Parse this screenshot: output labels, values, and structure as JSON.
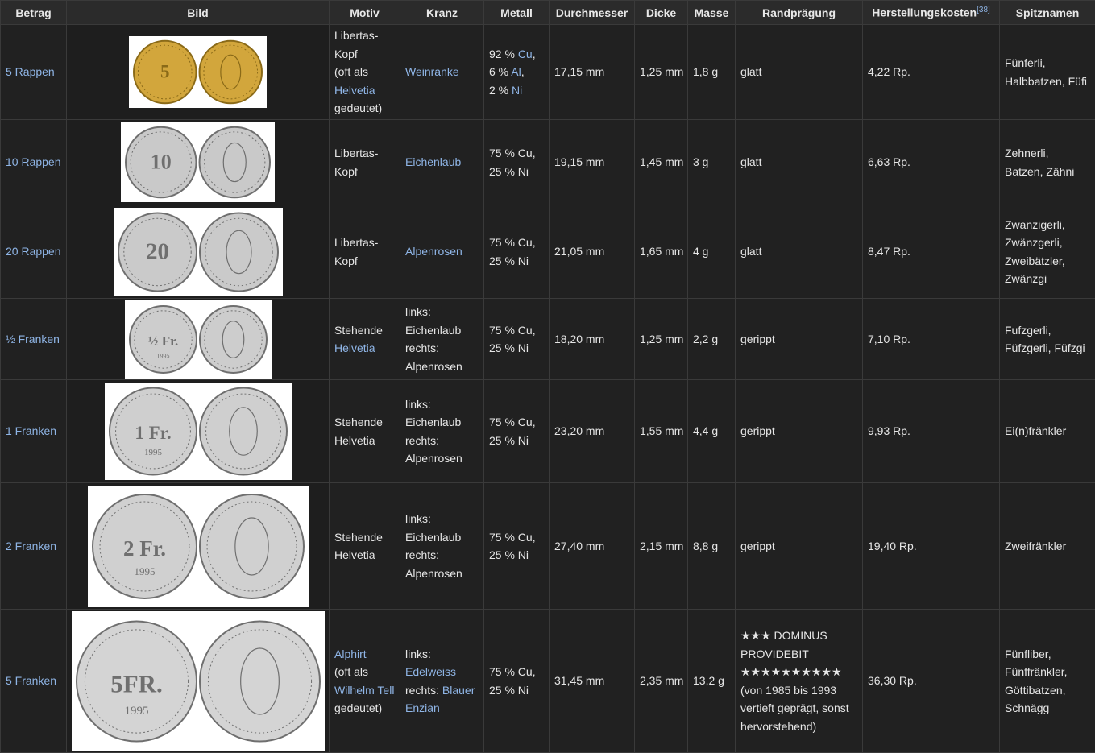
{
  "headers": {
    "betrag": "Betrag",
    "bild": "Bild",
    "motiv": "Motiv",
    "kranz": "Kranz",
    "metall": "Metall",
    "durchmesser": "Durchmesser",
    "dicke": "Dicke",
    "masse": "Masse",
    "rand": "Randprägung",
    "kosten": "Herstellungskosten",
    "kosten_ref": "[38]",
    "spitz": "Spitznamen"
  },
  "rows": [
    {
      "betrag": "5 Rappen",
      "coin_color": "#d2a63c",
      "coin_text": "5",
      "motiv": [
        "Libertas-",
        "Kopf",
        "(oft als",
        "Helvetia",
        "gedeutet)"
      ],
      "kranz": [
        "Weinranke"
      ],
      "metall": [
        "92 % Cu,",
        "6 % Al,",
        "2 % Ni"
      ],
      "durchmesser": "17,15 mm",
      "dicke": "1,25 mm",
      "masse": "1,8 g",
      "rand": [
        "glatt"
      ],
      "kosten": "4,22 Rp.",
      "spitz": [
        "Fünferli,",
        "Halbbatzen, Füfi"
      ]
    },
    {
      "betrag": "10 Rappen",
      "coin_color": "#c9c9c9",
      "coin_text": "10",
      "motiv": [
        "Libertas-",
        "Kopf"
      ],
      "kranz": [
        "Eichenlaub"
      ],
      "metall": [
        "75 % Cu,",
        "25 % Ni"
      ],
      "durchmesser": "19,15 mm",
      "dicke": "1,45 mm",
      "masse": "3 g",
      "rand": [
        "glatt"
      ],
      "kosten": "6,63 Rp.",
      "spitz": [
        "Zehnerli,",
        "Batzen, Zähni"
      ]
    },
    {
      "betrag": "20 Rappen",
      "coin_color": "#cacaca",
      "coin_text": "20",
      "motiv": [
        "Libertas-",
        "Kopf"
      ],
      "kranz": [
        "Alpenrosen"
      ],
      "metall": [
        "75 % Cu,",
        "25 % Ni"
      ],
      "durchmesser": "21,05 mm",
      "dicke": "1,65 mm",
      "masse": "4 g",
      "rand": [
        "glatt"
      ],
      "kosten": "8,47 Rp.",
      "spitz": [
        "Zwanzigerli,",
        "Zwänzgerli,",
        "Zweibätzler,",
        "Zwänzgi"
      ]
    },
    {
      "betrag": "½ Franken",
      "coin_color": "#cdcdcd",
      "coin_text": "½ Fr.",
      "coin_year": "1995",
      "motiv": [
        "Stehende",
        "Helvetia"
      ],
      "kranz": [
        "links:",
        "Eichenlaub",
        "rechts:",
        "Alpenrosen"
      ],
      "metall": [
        "75 % Cu,",
        "25 % Ni"
      ],
      "durchmesser": "18,20 mm",
      "dicke": "1,25 mm",
      "masse": "2,2 g",
      "rand": [
        "gerippt"
      ],
      "kosten": "7,10 Rp.",
      "spitz": [
        "Fufzgerli,",
        "Füfzgerli, Füfzgi"
      ]
    },
    {
      "betrag": "1 Franken",
      "coin_color": "#cfcfcf",
      "coin_text": "1 Fr.",
      "coin_year": "1995",
      "motiv": [
        "Stehende",
        "Helvetia"
      ],
      "kranz": [
        "links:",
        "Eichenlaub",
        "rechts:",
        "Alpenrosen"
      ],
      "metall": [
        "75 % Cu,",
        "25 % Ni"
      ],
      "durchmesser": "23,20 mm",
      "dicke": "1,55 mm",
      "masse": "4,4 g",
      "rand": [
        "gerippt"
      ],
      "kosten": "9,93 Rp.",
      "spitz": [
        "Ei(n)fränkler"
      ]
    },
    {
      "betrag": "2 Franken",
      "coin_color": "#d0d0d0",
      "coin_text": "2 Fr.",
      "coin_year": "1995",
      "motiv": [
        "Stehende",
        "Helvetia"
      ],
      "kranz": [
        "links:",
        "Eichenlaub",
        "rechts:",
        "Alpenrosen"
      ],
      "metall": [
        "75 % Cu,",
        "25 % Ni"
      ],
      "durchmesser": "27,40 mm",
      "dicke": "2,15 mm",
      "masse": "8,8 g",
      "rand": [
        "gerippt"
      ],
      "kosten": "19,40 Rp.",
      "spitz": [
        "Zweifränkler"
      ]
    },
    {
      "betrag": "5 Franken",
      "coin_color": "#d4d4d4",
      "coin_text": "5FR.",
      "coin_year": "1995",
      "motiv": [
        "Alphirt",
        "(oft als",
        "Wilhelm Tell",
        "gedeutet)"
      ],
      "kranz": [
        "links:",
        "Edelweiss",
        "rechts: Blauer",
        "Enzian"
      ],
      "metall": [
        "75 % Cu,",
        "25 % Ni"
      ],
      "durchmesser": "31,45 mm",
      "dicke": "2,35 mm",
      "masse": "13,2 g",
      "rand": [
        "★★★ DOMINUS",
        "PROVIDEBIT",
        "★★★★★★★★★★",
        "(von 1985 bis 1993",
        "vertieft geprägt, sonst",
        "hervorstehend)"
      ],
      "kosten": "36,30 Rp.",
      "spitz": [
        "Fünfliber,",
        "Fünffränkler,",
        "Göttibatzen,",
        "Schnägg"
      ]
    }
  ]
}
